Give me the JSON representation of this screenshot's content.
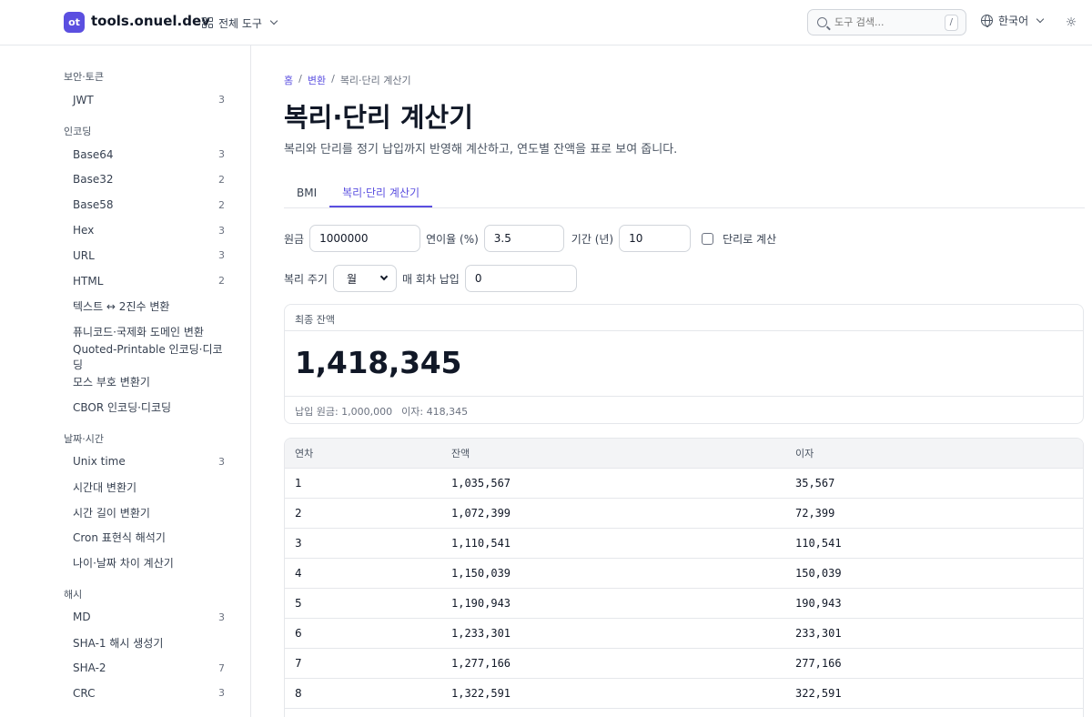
{
  "header": {
    "logo_text": "ot",
    "brand": "tools.onuel.dev",
    "all_tools": "전체 도구",
    "search_placeholder": "도구 검색...",
    "search_shortcut": "/",
    "language": "한국어",
    "theme_icon": "sun-icon"
  },
  "sidebar": {
    "categories": [
      {
        "title": "보안·토큰",
        "items": [
          {
            "label": "JWT",
            "count": "3"
          }
        ]
      },
      {
        "title": "인코딩",
        "items": [
          {
            "label": "Base64",
            "count": "3"
          },
          {
            "label": "Base32",
            "count": "2"
          },
          {
            "label": "Base58",
            "count": "2"
          },
          {
            "label": "Hex",
            "count": "3"
          },
          {
            "label": "URL",
            "count": "3"
          },
          {
            "label": "HTML",
            "count": "2"
          },
          {
            "label": "텍스트 ↔ 2진수 변환",
            "count": ""
          },
          {
            "label": "퓨니코드·국제화 도메인 변환",
            "count": ""
          },
          {
            "label": "Quoted-Printable 인코딩·디코딩",
            "count": ""
          },
          {
            "label": "모스 부호 변환기",
            "count": ""
          },
          {
            "label": "CBOR 인코딩·디코딩",
            "count": ""
          }
        ]
      },
      {
        "title": "날짜·시간",
        "items": [
          {
            "label": "Unix time",
            "count": "3"
          },
          {
            "label": "시간대 변환기",
            "count": ""
          },
          {
            "label": "시간 길이 변환기",
            "count": ""
          },
          {
            "label": "Cron 표현식 해석기",
            "count": ""
          },
          {
            "label": "나이·날짜 차이 계산기",
            "count": ""
          }
        ]
      },
      {
        "title": "해시",
        "items": [
          {
            "label": "MD",
            "count": "3"
          },
          {
            "label": "SHA-1 해시 생성기",
            "count": ""
          },
          {
            "label": "SHA-2",
            "count": "7"
          },
          {
            "label": "CRC",
            "count": "3"
          }
        ]
      }
    ]
  },
  "breadcrumb": {
    "home": "홈",
    "section": "변환",
    "current": "복리·단리 계산기"
  },
  "page": {
    "title": "복리·단리 계산기",
    "description": "복리와 단리를 정기 납입까지 반영해 계산하고, 연도별 잔액을 표로 보여 줍니다."
  },
  "tabs": [
    {
      "label": "BMI",
      "active": false
    },
    {
      "label": "복리·단리 계산기",
      "active": true
    }
  ],
  "form": {
    "principal_label": "원금",
    "principal_value": "1000000",
    "rate_label": "연이율 (%)",
    "rate_value": "3.5",
    "period_label": "기간 (년)",
    "period_value": "10",
    "simple_label": "단리로 계산",
    "compound_label": "복리 주기",
    "compound_value": "월",
    "deposit_label": "매 회차 납입",
    "deposit_value": "0"
  },
  "result": {
    "label": "최종 잔액",
    "value": "1,418,345",
    "principal_note": "납입 원금: 1,000,000",
    "interest_note": "이자: 418,345"
  },
  "table": {
    "headers": [
      "연차",
      "잔액",
      "이자"
    ],
    "rows": [
      [
        "1",
        "1,035,567",
        "35,567"
      ],
      [
        "2",
        "1,072,399",
        "72,399"
      ],
      [
        "3",
        "1,110,541",
        "110,541"
      ],
      [
        "4",
        "1,150,039",
        "150,039"
      ],
      [
        "5",
        "1,190,943",
        "190,943"
      ],
      [
        "6",
        "1,233,301",
        "233,301"
      ],
      [
        "7",
        "1,277,166",
        "277,166"
      ],
      [
        "8",
        "1,322,591",
        "322,591"
      ],
      [
        "",
        "",
        ""
      ]
    ]
  },
  "colors": {
    "accent": "#5b4fe0",
    "border": "#e5e7eb",
    "header_bg": "#f3f4f6"
  }
}
